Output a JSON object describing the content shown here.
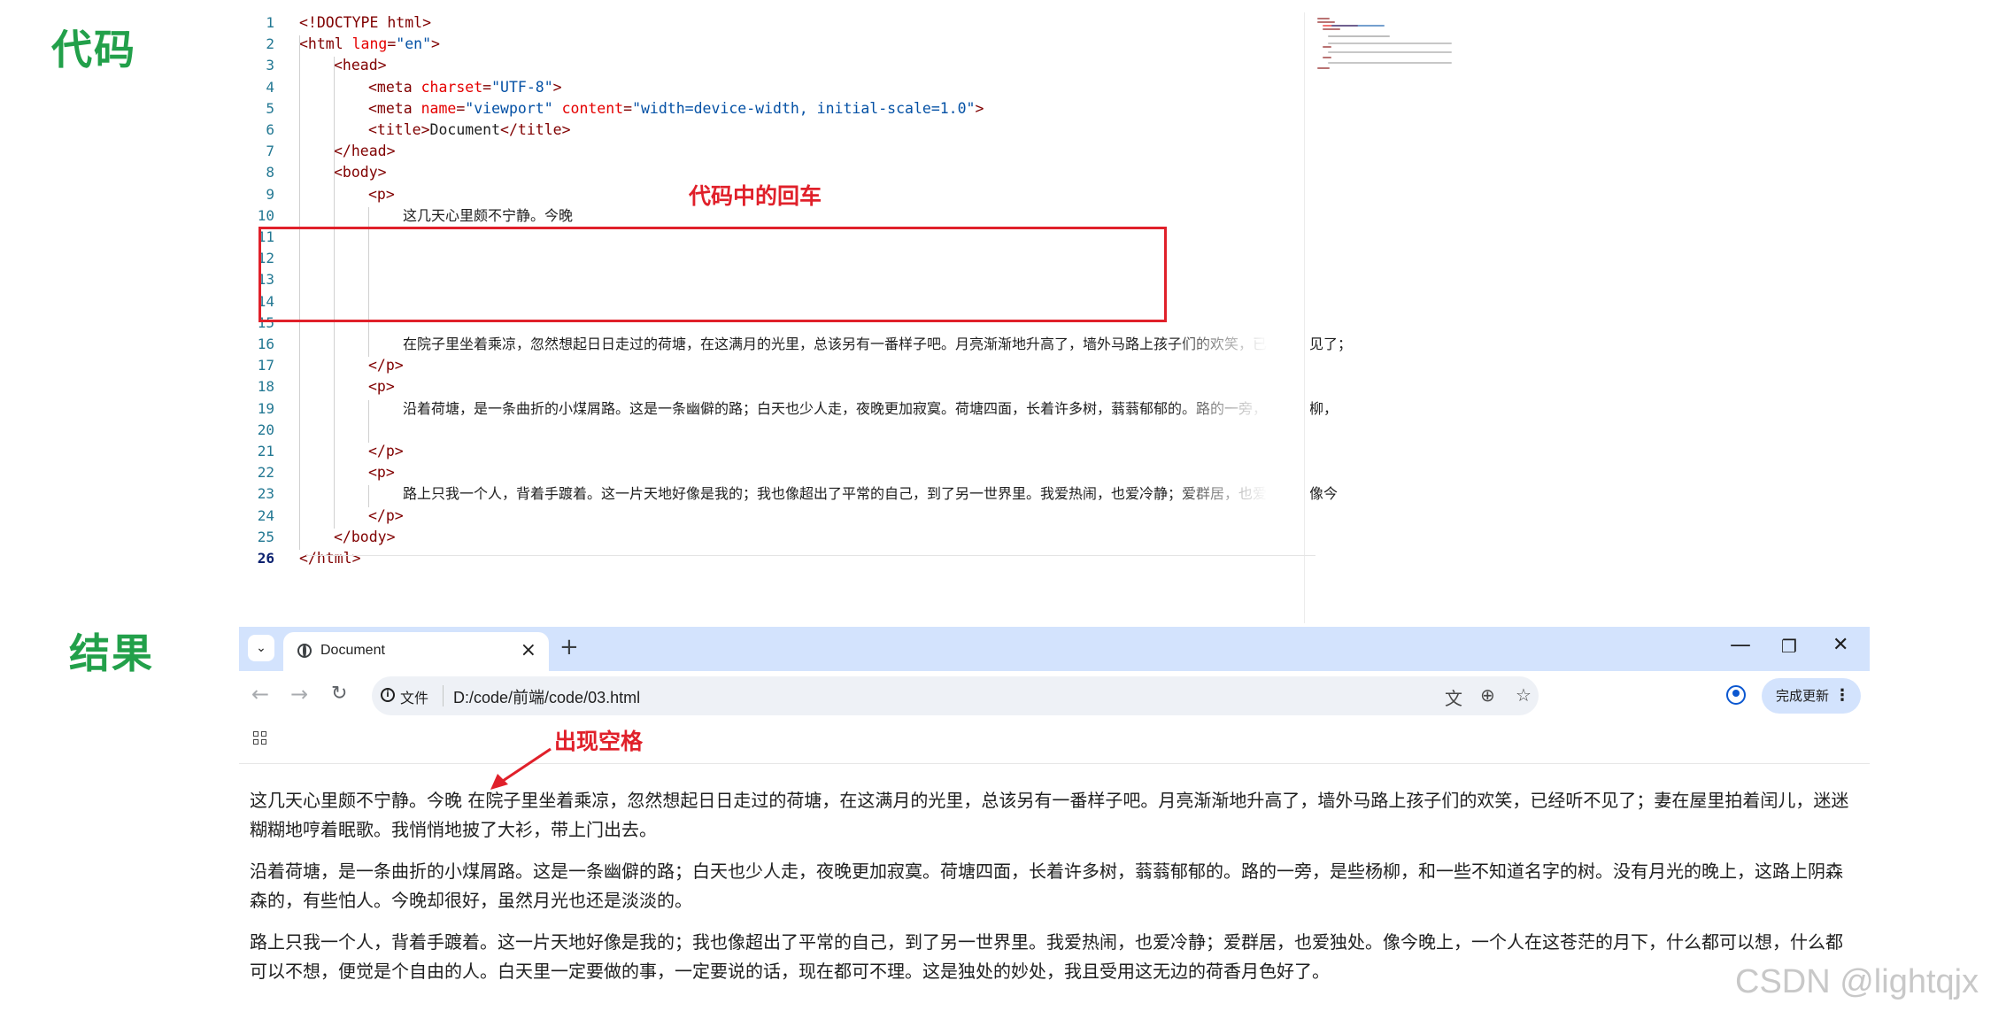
{
  "labels": {
    "code_section": "代码",
    "result_section": "结果",
    "annotation_enter": "代码中的回车",
    "annotation_space": "出现空格"
  },
  "editor": {
    "lines": [
      {
        "n": "1",
        "indent": 0,
        "tokens": [
          [
            "tag",
            "<!DOCTYPE html>"
          ]
        ]
      },
      {
        "n": "2",
        "indent": 0,
        "tokens": [
          [
            "tag",
            "<html "
          ],
          [
            "attr",
            "lang"
          ],
          [
            "tag",
            "="
          ],
          [
            "val",
            "\"en\""
          ],
          [
            "tag",
            ">"
          ]
        ]
      },
      {
        "n": "3",
        "indent": 1,
        "tokens": [
          [
            "tag",
            "<head>"
          ]
        ]
      },
      {
        "n": "4",
        "indent": 2,
        "tokens": [
          [
            "tag",
            "<meta "
          ],
          [
            "attr",
            "charset"
          ],
          [
            "tag",
            "="
          ],
          [
            "val",
            "\"UTF-8\""
          ],
          [
            "tag",
            ">"
          ]
        ]
      },
      {
        "n": "5",
        "indent": 2,
        "tokens": [
          [
            "tag",
            "<meta "
          ],
          [
            "attr",
            "name"
          ],
          [
            "tag",
            "="
          ],
          [
            "val",
            "\"viewport\""
          ],
          [
            "attr",
            " content"
          ],
          [
            "tag",
            "="
          ],
          [
            "val",
            "\"width=device-width, initial-scale=1.0\""
          ],
          [
            "tag",
            ">"
          ]
        ]
      },
      {
        "n": "6",
        "indent": 2,
        "tokens": [
          [
            "tag",
            "<title>"
          ],
          [
            "txt",
            "Document"
          ],
          [
            "tag",
            "</title>"
          ]
        ]
      },
      {
        "n": "7",
        "indent": 1,
        "tokens": [
          [
            "tag",
            "</head>"
          ]
        ]
      },
      {
        "n": "8",
        "indent": 1,
        "tokens": [
          [
            "tag",
            "<body>"
          ]
        ]
      },
      {
        "n": "9",
        "indent": 2,
        "tokens": [
          [
            "tag",
            "<p>"
          ]
        ]
      },
      {
        "n": "10",
        "indent": 3,
        "prose": true,
        "tokens": [
          [
            "txt",
            "这几天心里颇不宁静。今晚"
          ]
        ]
      },
      {
        "n": "11",
        "indent": 0,
        "tokens": []
      },
      {
        "n": "12",
        "indent": 0,
        "tokens": []
      },
      {
        "n": "13",
        "indent": 0,
        "tokens": []
      },
      {
        "n": "14",
        "indent": 0,
        "tokens": []
      },
      {
        "n": "15",
        "indent": 0,
        "tokens": []
      },
      {
        "n": "16",
        "indent": 3,
        "prose": true,
        "tokens": [
          [
            "txt",
            "在院子里坐着乘凉，忽然想起日日走过的荷塘，在这满月的光里，总该另有一番样子吧。月亮渐渐地升高了，墙外马路上孩子们的欢笑，已经听不见了；"
          ]
        ]
      },
      {
        "n": "17",
        "indent": 2,
        "tokens": [
          [
            "tag",
            "</p>"
          ]
        ]
      },
      {
        "n": "18",
        "indent": 2,
        "tokens": [
          [
            "tag",
            "<p>"
          ]
        ]
      },
      {
        "n": "19",
        "indent": 3,
        "prose": true,
        "tokens": [
          [
            "txt",
            "沿着荷塘，是一条曲折的小煤屑路。这是一条幽僻的路；白天也少人走，夜晚更加寂寞。荷塘四面，长着许多树，蓊蓊郁郁的。路的一旁，是些杨柳，"
          ]
        ]
      },
      {
        "n": "20",
        "indent": 0,
        "tokens": []
      },
      {
        "n": "21",
        "indent": 2,
        "tokens": [
          [
            "tag",
            "</p>"
          ]
        ]
      },
      {
        "n": "22",
        "indent": 2,
        "tokens": [
          [
            "tag",
            "<p>"
          ]
        ]
      },
      {
        "n": "23",
        "indent": 3,
        "prose": true,
        "tokens": [
          [
            "txt",
            "路上只我一个人，背着手踱着。这一片天地好像是我的；我也像超出了平常的自己，到了另一世界里。我爱热闹，也爱冷静；爱群居，也爱独处，像今"
          ]
        ]
      },
      {
        "n": "24",
        "indent": 2,
        "tokens": [
          [
            "tag",
            "</p>"
          ]
        ]
      },
      {
        "n": "25",
        "indent": 1,
        "tokens": [
          [
            "tag",
            "</body>"
          ]
        ]
      },
      {
        "n": "26",
        "indent": 0,
        "current": true,
        "tokens": [
          [
            "tag",
            "</html>"
          ]
        ]
      }
    ]
  },
  "browser": {
    "tab_title": "Document",
    "tab_menu_icon": "chevron-down-icon",
    "new_tab_label": "+",
    "window_controls": {
      "minimize": "—",
      "restore": "❐",
      "close": "✕"
    },
    "address": {
      "scheme_label": "文件",
      "url": "D:/code/前端/code/03.html"
    },
    "update_button": "完成更新",
    "paragraphs": [
      "这几天心里颇不宁静。今晚 在院子里坐着乘凉，忽然想起日日走过的荷塘，在这满月的光里，总该另有一番样子吧。月亮渐渐地升高了，墙外马路上孩子们的欢笑，已经听不见了；妻在屋里拍着闰儿，迷迷糊糊地哼着眠歌。我悄悄地披了大衫，带上门出去。",
      "沿着荷塘，是一条曲折的小煤屑路。这是一条幽僻的路；白天也少人走，夜晚更加寂寞。荷塘四面，长着许多树，蓊蓊郁郁的。路的一旁，是些杨柳，和一些不知道名字的树。没有月光的晚上，这路上阴森森的，有些怕人。今晚却很好，虽然月光也还是淡淡的。",
      "路上只我一个人，背着手踱着。这一片天地好像是我的；我也像超出了平常的自己，到了另一世界里。我爱热闹，也爱冷静；爱群居，也爱独处。像今晚上，一个人在这苍茫的月下，什么都可以想，什么都可以不想，便觉是个自由的人。白天里一定要做的事，一定要说的话，现在都可不理。这是独处的妙处，我且受用这无边的荷香月色好了。"
    ]
  },
  "watermark": "CSDN @lightqjx",
  "colors": {
    "section_label": "#22a04a",
    "annotation": "#e0202a",
    "tab_bar": "#d3e3fd",
    "tag": "#800000",
    "attribute": "#e50000",
    "attribute_value": "#0451a5"
  }
}
